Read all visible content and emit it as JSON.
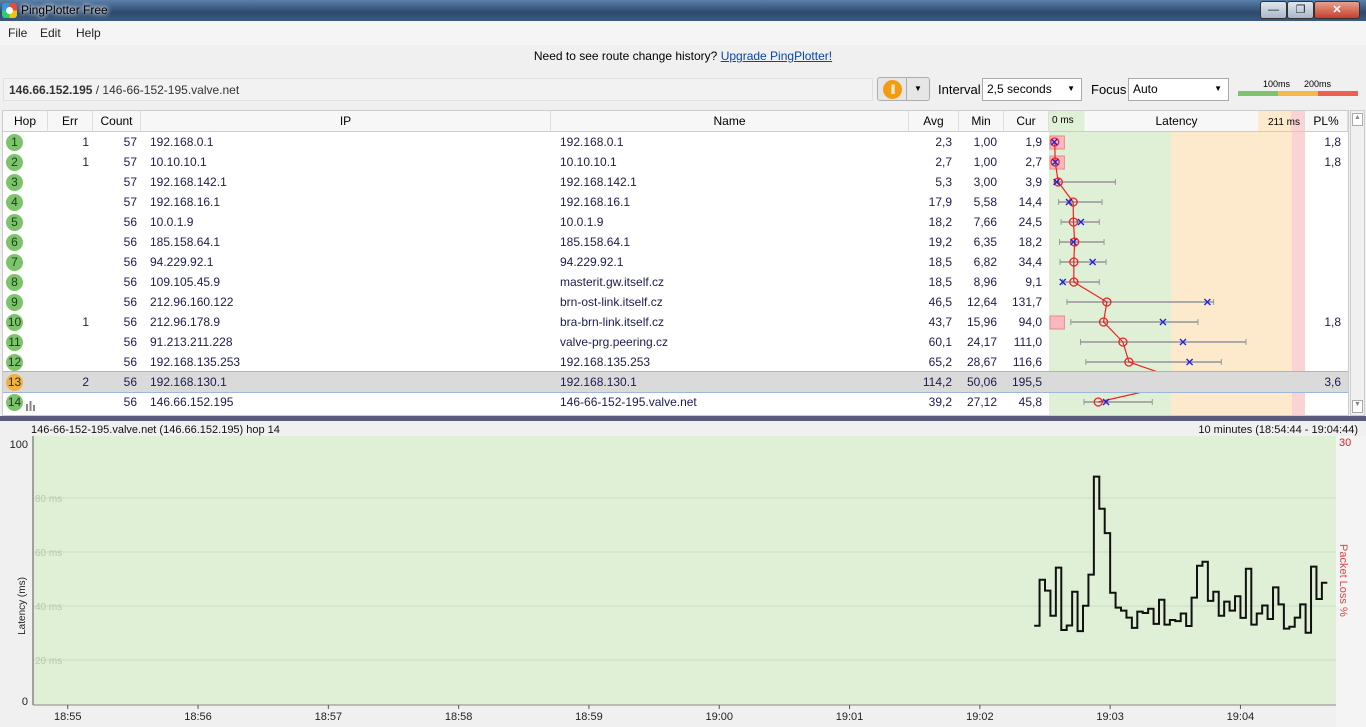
{
  "window": {
    "title": "PingPlotter Free",
    "controls": [
      "minimize",
      "maximize",
      "close"
    ]
  },
  "menu": [
    "File",
    "Edit",
    "Help"
  ],
  "banner": {
    "text": "Need to see route change history?",
    "link": "Upgrade PingPlotter!"
  },
  "toolbar": {
    "target_ip": "146.66.152.195",
    "target_name": " / 146-66-152-195.valve.net",
    "interval_label": "Interval",
    "interval_value": "2,5 seconds",
    "focus_label": "Focus",
    "focus_value": "Auto",
    "legend": {
      "l100": "100ms",
      "l200": "200ms",
      "colors": [
        "#7cc36b",
        "#f7b84b",
        "#f06050"
      ]
    }
  },
  "table": {
    "headers": {
      "hop": "Hop",
      "err": "Err",
      "count": "Count",
      "ip": "IP",
      "name": "Name",
      "avg": "Avg",
      "min": "Min",
      "cur": "Cur",
      "latency": "Latency",
      "lat_min": "0 ms",
      "lat_max": "211 ms",
      "pl": "PL%"
    },
    "latency_scale_max_ms": 211,
    "rows": [
      {
        "hop": "1",
        "err": "1",
        "count": "57",
        "ip": "192.168.0.1",
        "name": "192.168.0.1",
        "avg": "2,3",
        "min": "1,00",
        "cur": "1,9",
        "pl": "1,8",
        "max_est": 3
      },
      {
        "hop": "2",
        "err": "1",
        "count": "57",
        "ip": "10.10.10.1",
        "name": "10.10.10.1",
        "avg": "2,7",
        "min": "1,00",
        "cur": "2,7",
        "pl": "1,8",
        "max_est": 3.5
      },
      {
        "hop": "3",
        "err": "",
        "count": "57",
        "ip": "192.168.142.1",
        "name": "192.168.142.1",
        "avg": "5,3",
        "min": "3,00",
        "cur": "3,9",
        "pl": "",
        "max_est": 53.7
      },
      {
        "hop": "4",
        "err": "",
        "count": "57",
        "ip": "192.168.16.1",
        "name": "192.168.16.1",
        "avg": "17,9",
        "min": "5,58",
        "cur": "14,4",
        "pl": "",
        "max_est": 42.4
      },
      {
        "hop": "5",
        "err": "",
        "count": "56",
        "ip": "10.0.1.9",
        "name": "10.0.1.9",
        "avg": "18,2",
        "min": "7,66",
        "cur": "24,5",
        "pl": "",
        "max_est": 40.1
      },
      {
        "hop": "6",
        "err": "",
        "count": "56",
        "ip": "185.158.64.1",
        "name": "185.158.64.1",
        "avg": "19,2",
        "min": "6,35",
        "cur": "18,2",
        "pl": "",
        "max_est": 44.1
      },
      {
        "hop": "7",
        "err": "",
        "count": "56",
        "ip": "94.229.92.1",
        "name": "94.229.92.1",
        "avg": "18,5",
        "min": "6,82",
        "cur": "34,4",
        "pl": "",
        "max_est": 45.8
      },
      {
        "hop": "8",
        "err": "",
        "count": "56",
        "ip": "109.105.45.9",
        "name": "masterit.gw.itself.cz",
        "avg": "18,5",
        "min": "8,96",
        "cur": "9,1",
        "pl": "",
        "max_est": 40.1
      },
      {
        "hop": "9",
        "err": "",
        "count": "56",
        "ip": "212.96.160.122",
        "name": "brn-ost-link.itself.cz",
        "avg": "46,5",
        "min": "12,64",
        "cur": "131,7",
        "pl": "",
        "max_est": 137
      },
      {
        "hop": "10",
        "err": "1",
        "count": "56",
        "ip": "212.96.178.9",
        "name": "bra-brn-link.itself.cz",
        "avg": "43,7",
        "min": "15,96",
        "cur": "94,0",
        "pl": "1,8",
        "max_est": 123.7
      },
      {
        "hop": "11",
        "err": "",
        "count": "56",
        "ip": "91.213.211.228",
        "name": "valve-prg.peering.cz",
        "avg": "60,1",
        "min": "24,17",
        "cur": "111,0",
        "pl": "",
        "max_est": 164.4
      },
      {
        "hop": "12",
        "err": "",
        "count": "56",
        "ip": "192.168.135.253",
        "name": "192.168.135.253",
        "avg": "65,2",
        "min": "28,67",
        "cur": "116,6",
        "pl": "",
        "max_est": 143.5
      },
      {
        "hop": "13",
        "err": "2",
        "count": "56",
        "ip": "192.168.130.1",
        "name": "192.168.130.1",
        "avg": "114,2",
        "min": "50,06",
        "cur": "195,5",
        "pl": "3,6",
        "max_est": 211,
        "status": "warning"
      },
      {
        "hop": "14",
        "err": "",
        "count": "56",
        "ip": "146.66.152.195",
        "name": "146-66-152-195.valve.net",
        "avg": "39,2",
        "min": "27,12",
        "cur": "45,8",
        "pl": "",
        "max_est": 85
      }
    ]
  },
  "graph": {
    "title": "146-66-152-195.valve.net (146.66.152.195) hop 14",
    "range": "10 minutes (18:54:44 - 19:04:44)",
    "chart_data": {
      "type": "line",
      "ylabel": "Latency (ms)",
      "y2label": "Packet Loss %",
      "ylim": [
        0,
        100
      ],
      "y2max_label": "30",
      "yticks": [
        {
          "v": 0,
          "l": "0"
        },
        {
          "v": 20,
          "l": "20 ms"
        },
        {
          "v": 40,
          "l": "40 ms"
        },
        {
          "v": 60,
          "l": "60 ms"
        },
        {
          "v": 80,
          "l": "80 ms"
        },
        {
          "v": 100,
          "l": "100"
        }
      ],
      "xlim_seconds": [
        0,
        600
      ],
      "xticks": [
        {
          "s": 16,
          "l": "18:55"
        },
        {
          "s": 76,
          "l": "18:56"
        },
        {
          "s": 136,
          "l": "18:57"
        },
        {
          "s": 196,
          "l": "18:58"
        },
        {
          "s": 256,
          "l": "18:59"
        },
        {
          "s": 316,
          "l": "19:00"
        },
        {
          "s": 376,
          "l": "19:01"
        },
        {
          "s": 436,
          "l": "19:02"
        },
        {
          "s": 496,
          "l": "19:03"
        },
        {
          "s": 556,
          "l": "19:04"
        }
      ],
      "series_start_seconds": 461,
      "sample_interval_seconds": 2.5,
      "values": [
        32.7,
        49.7,
        45.7,
        36.4,
        54.2,
        31.1,
        32.8,
        45.3,
        30.7,
        40.1,
        51.6,
        87.9,
        76.0,
        67.0,
        44.9,
        39.4,
        38.3,
        35.7,
        31.9,
        37.9,
        37.4,
        39.0,
        33.4,
        42.3,
        33.1,
        34.8,
        34.4,
        37.2,
        32.6,
        43.1,
        54.9,
        56.4,
        41.9,
        45.3,
        36.4,
        41.6,
        38.3,
        43.6,
        35.6,
        53.8,
        33.1,
        37.2,
        40.2,
        35.2,
        46.9,
        40.6,
        31.6,
        32.3,
        35.7,
        40.6,
        30.1,
        54.6,
        42.6,
        48.6
      ]
    }
  }
}
